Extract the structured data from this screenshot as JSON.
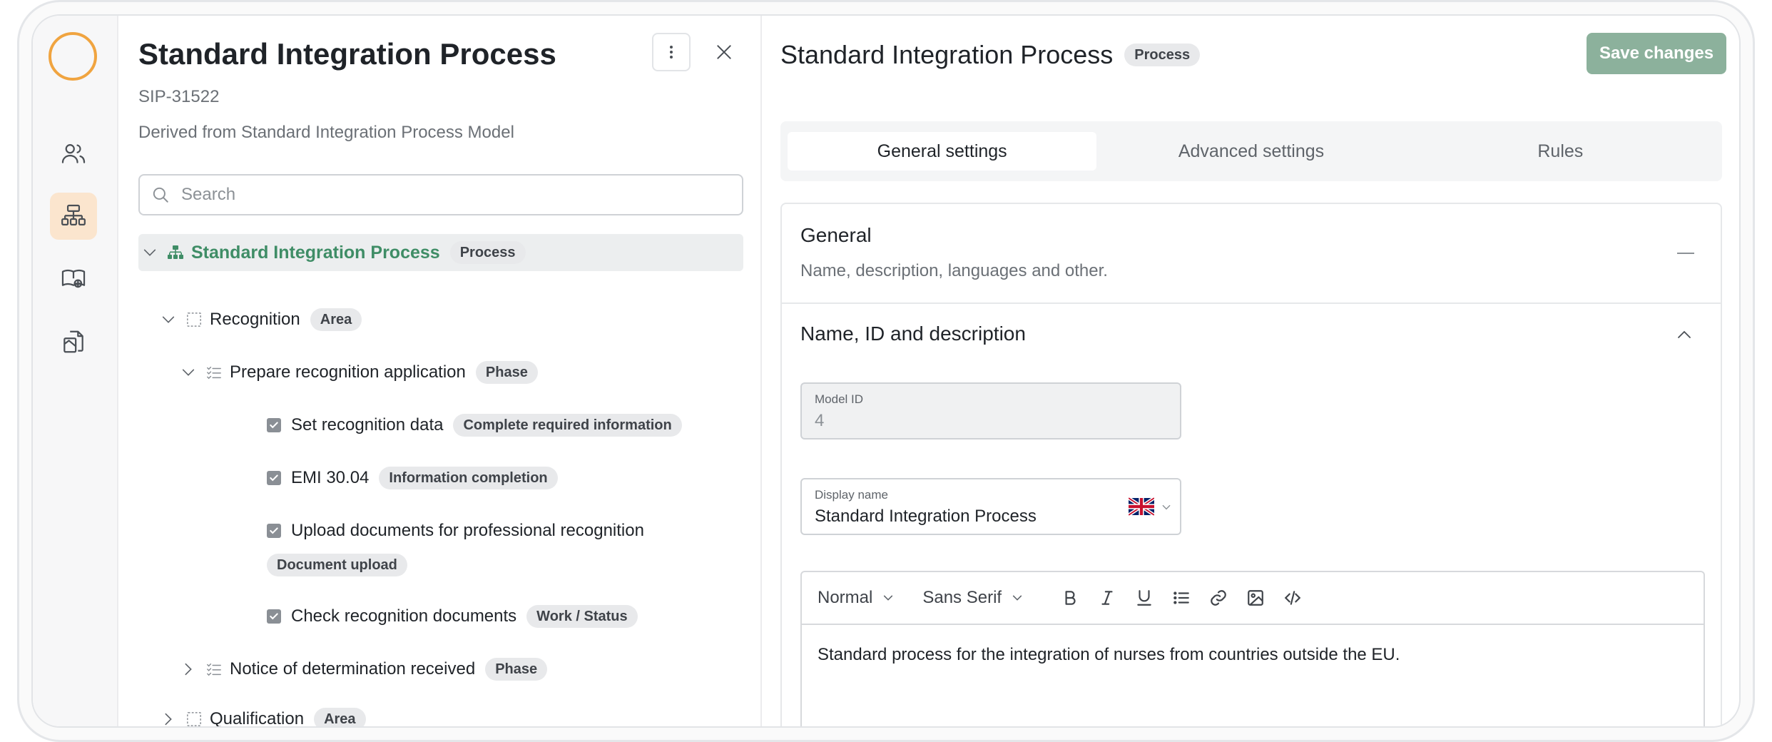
{
  "tree_panel": {
    "title": "Standard Integration Process",
    "code": "SIP-31522",
    "derived": "Derived from Standard Integration Process Model",
    "search_placeholder": "Search",
    "nodes": [
      {
        "label": "Standard Integration Process",
        "badge": "Process"
      },
      {
        "label": "Recognition",
        "badge": "Area"
      },
      {
        "label": "Prepare recognition application",
        "badge": "Phase"
      },
      {
        "label": "Set recognition data",
        "badge": "Complete required information"
      },
      {
        "label": "EMI 30.04",
        "badge": "Information completion"
      },
      {
        "label": "Upload documents for professional recognition",
        "badge": "Document upload"
      },
      {
        "label": "Check recognition documents",
        "badge": "Work / Status"
      },
      {
        "label": "Notice of determination received",
        "badge": "Phase"
      },
      {
        "label": "Qualification",
        "badge": "Area"
      }
    ]
  },
  "main": {
    "title": "Standard Integration Process",
    "badge": "Process",
    "save_label": "Save changes",
    "tabs": [
      {
        "label": "General settings",
        "active": true
      },
      {
        "label": "Advanced settings",
        "active": false
      },
      {
        "label": "Rules",
        "active": false
      }
    ],
    "general": {
      "heading": "General",
      "description": "Name, description, languages and other."
    },
    "name_section": {
      "heading": "Name, ID and description",
      "model_id_label": "Model ID",
      "model_id_value": "4",
      "display_name_label": "Display name",
      "display_name_value": "Standard Integration Process",
      "editor": {
        "format": "Normal",
        "font": "Sans Serif",
        "content": "Standard process for the integration of nurses from countries outside the EU."
      }
    }
  },
  "colors": {
    "accent_green": "#3f8d66",
    "save_button": "#8cb19c",
    "logo_orange": "#f0a440",
    "active_rail": "#fbe5ce"
  },
  "icons": {
    "rail": [
      "users-icon",
      "hierarchy-icon",
      "map-book-icon",
      "documents-icon"
    ]
  }
}
